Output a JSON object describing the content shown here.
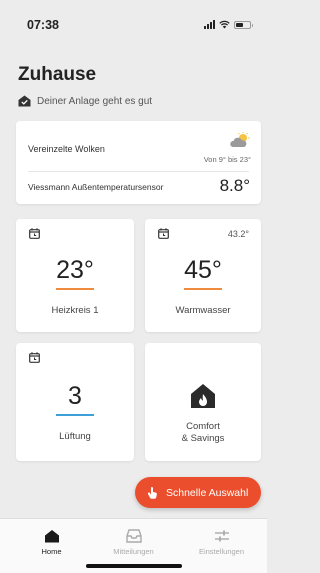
{
  "status_bar": {
    "time": "07:38"
  },
  "header": {
    "title": "Zuhause",
    "status_message": "Deiner Anlage geht es gut"
  },
  "weather": {
    "description": "Vereinzelte Wolken",
    "range": "Von 9° bis 23°",
    "icon": "partly-cloudy-icon",
    "sensor_label": "Viessmann Außentemperatursensor",
    "sensor_value": "8.8°"
  },
  "tiles": [
    {
      "value": "23°",
      "label": "Heizkreis 1",
      "icon": "schedule-icon",
      "underline_color": "#f08a3c"
    },
    {
      "value": "45°",
      "label": "Warmwasser",
      "icon": "schedule-icon",
      "top_right": "43.2°",
      "underline_color": "#f08a3c"
    },
    {
      "value": "3",
      "label": "Lüftung",
      "icon": "schedule-icon",
      "underline_color": "#3da0d8"
    },
    {
      "label_line1": "Comfort",
      "label_line2": "& Savings",
      "icon": "house-flame-icon"
    }
  ],
  "fab": {
    "label": "Schnelle Auswahl",
    "icon": "hand-pointer-icon",
    "color": "#ea4e2c"
  },
  "tab_bar": {
    "items": [
      {
        "label": "Home",
        "icon": "house-icon",
        "active": true
      },
      {
        "label": "Mitteilungen",
        "icon": "inbox-icon",
        "active": false
      },
      {
        "label": "Einstellungen",
        "icon": "sliders-icon",
        "active": false
      }
    ]
  }
}
